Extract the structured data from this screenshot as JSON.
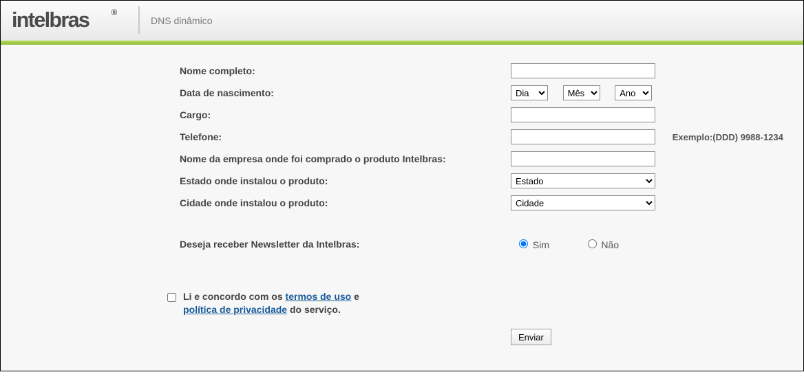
{
  "header": {
    "brand": "intelbras",
    "subtitle": "DNS dinâmico"
  },
  "form": {
    "fullname": {
      "label": "Nome completo:",
      "value": ""
    },
    "dob": {
      "label": "Data de nascimento:",
      "day_placeholder": "Dia",
      "month_placeholder": "Mês",
      "year_placeholder": "Ano"
    },
    "jobtitle": {
      "label": "Cargo:",
      "value": ""
    },
    "phone": {
      "label": "Telefone:",
      "value": "",
      "hint": "Exemplo:(DDD) 9988-1234"
    },
    "company": {
      "label": "Nome da empresa onde foi comprado o produto Intelbras:",
      "value": ""
    },
    "state": {
      "label": "Estado onde instalou o produto:",
      "placeholder": "Estado"
    },
    "city": {
      "label": "Cidade onde instalou o produto:",
      "placeholder": "Cidade"
    },
    "newsletter": {
      "label": "Deseja receber Newsletter da Intelbras:",
      "yes": "Sim",
      "no": "Não",
      "selected": "yes"
    },
    "terms": {
      "prefix": "Li e concordo com os ",
      "link1": "termos de uso",
      "mid": " e ",
      "link2": "política de privacidade",
      "suffix": " do serviço."
    },
    "submit_label": "Enviar"
  }
}
